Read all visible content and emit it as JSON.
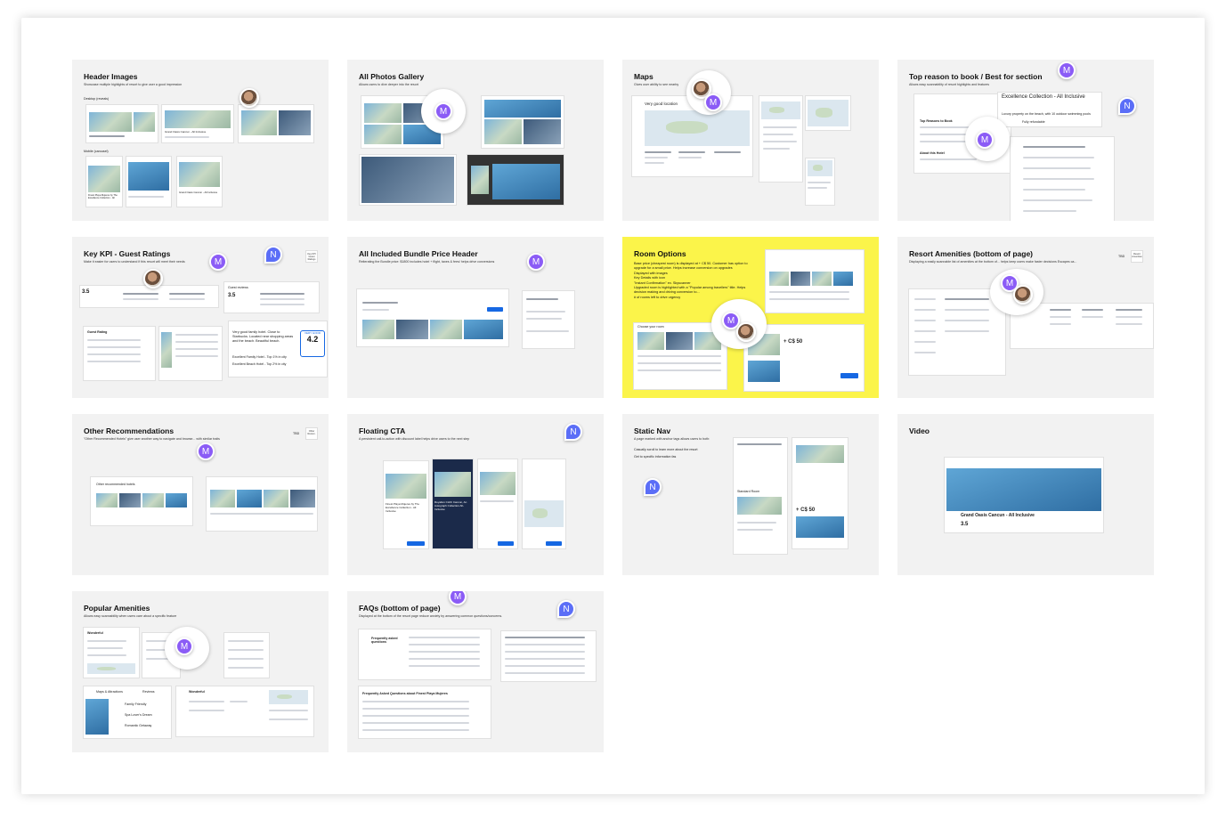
{
  "cards": [
    {
      "title": "Header Images",
      "desc": "Showcase multiple highlights of resort to give user a good impression",
      "notes": [
        "Desktop (reveals)",
        "Mobile (carousel)"
      ],
      "labels": [
        "Grand Oasis Cancun - All Inclusive",
        "Grand Oasis Cancun - All Inclusive",
        "Finest Playa Mujeres by The Excellence Collection - All"
      ]
    },
    {
      "title": "All Photos Gallery",
      "desc": "Allows users to dive deeper into the resort"
    },
    {
      "title": "Maps",
      "desc": "Gives user ability to see nearby",
      "notes": [
        "Very good location"
      ]
    },
    {
      "title": "Top reason to book / Best for section",
      "desc": "Allows easy scannability of resort highlights and features",
      "notes": [
        "Excellence Collection - All Inclusive",
        "Luxury property on the beach, with 10 outdoor swimming pools",
        "Top Reasons to Book",
        "About this Hotel",
        "Fully refundable"
      ]
    },
    {
      "title": "Key KPI - Guest Ratings",
      "desc": "Make it easier for users to understand if this resort will meet their needs",
      "notes": [
        "Key KPI Guest Ratings",
        "Guest reviews",
        "Very good family hotel. Close to Starbucks. Located near shopping areas and the beach. Beautiful beach.",
        "Excellent Family Hotel - Top 1% in city",
        "Excellent Beach Hotel - Top 2% in city",
        "VERY GOOD",
        "4.2",
        "Guest Rating"
      ]
    },
    {
      "title": "All Included Bundle Price Header",
      "desc": "Reiterating the Bundle price: $1800 includes hotel + flight, taxes & fees/ helps drive conversions"
    },
    {
      "title": "Room Options",
      "desc": "",
      "bullets": [
        "Base price (cheapest room) is displayed at + C$ 50. Customer has option to upgrade for a small price. Helps increase conversion on upgrades",
        "Displayed with images",
        "Key Details with icon",
        "\"Instant Confirmation\" ex. Skyscanner",
        "Upgraded room is highlighted with a \"Popular among travellers\" title. Helps decision making and driving conversion to...",
        "# of rooms left to drive urgency"
      ],
      "notes": [
        "Choose your room",
        "+ C$ 50"
      ]
    },
    {
      "title": "Resort Amenities (bottom of page)",
      "desc": "Displaying a easily scannable list of amenities at the bottom of... helps keep users make faster decisions Escapes ca...",
      "notes": [
        "TBD",
        "Resort Amenities"
      ]
    },
    {
      "title": "Other Recommendations",
      "desc": "\"Other Recommended Hotels\" give user another way to navigate and browse... with similar traits",
      "notes": [
        "TBD",
        "Other Recom.",
        "Other recommended hotels"
      ]
    },
    {
      "title": "Floating CTA",
      "desc": "A persistent call-to-action with discount label helps drive users to the next step",
      "notes": [
        "Finest Playa Mujeres by The Excellence Collection - All Inclusive",
        "Royalton CHIC Cancun, An Autograph Collection All-Inclusive"
      ]
    },
    {
      "title": "Static Nav",
      "desc": "A page marked with anchor tags allows users to both:",
      "bullets": [
        "Casually scroll to learn more about the resort",
        "Get to specific information fas"
      ],
      "notes": [
        "Standard Room",
        "+ C$ 50"
      ]
    },
    {
      "title": "Video",
      "desc": "",
      "notes": [
        "Grand Oasis Cancun - All Inclusive",
        "3.5"
      ]
    },
    {
      "title": "Popular Amenities",
      "desc": "Allows easy scannability when users care about a specific feature",
      "notes": [
        "Wonderful",
        "Wonderful",
        "Maps & Attractions",
        "Reviews",
        "Family Friendly",
        "Spa Lover's Dream",
        "Romantic Getaway"
      ]
    },
    {
      "title": "FAQs (bottom of page)",
      "desc": "Displayed at the bottom of the resort page reduce anxiety by answering common questions/concerns.",
      "notes": [
        "Frequently asked questions",
        "Frequently Asked Questions about Finest Playa Mujeres"
      ]
    }
  ],
  "avatars": {
    "m": "M",
    "n": "N"
  },
  "colors": {
    "card_bg": "#f2f2f2",
    "highlight": "#fbf44a",
    "avatar_m": "#8b5cf6",
    "avatar_n": "#5b6ef7",
    "link": "#1668e3"
  }
}
